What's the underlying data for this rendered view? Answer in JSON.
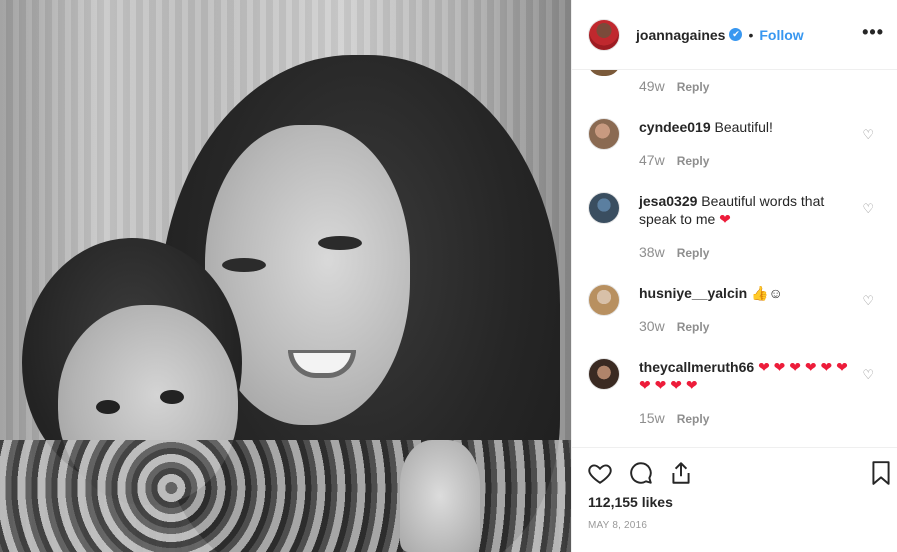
{
  "post": {
    "username": "joannagaines",
    "verified_mark": "✔",
    "separator": "•",
    "follow_label": "Follow",
    "more_label": "•••"
  },
  "comments": {
    "top_partial": {
      "age": "49w",
      "reply_label": "Reply"
    },
    "items": [
      {
        "user": "cyndee019",
        "text": "Beautiful!",
        "emoji": "",
        "age": "47w",
        "reply_label": "Reply"
      },
      {
        "user": "jesa0329",
        "text": "Beautiful words that speak to me",
        "emoji": "❤",
        "age": "38w",
        "reply_label": "Reply"
      },
      {
        "user": "husniye__yalcin",
        "text": "",
        "emoji": "👍☺",
        "age": "30w",
        "reply_label": "Reply"
      },
      {
        "user": "theycallmeruth66",
        "text": "",
        "emoji": "❤ ❤ ❤ ❤ ❤ ❤ ❤ ❤ ❤ ❤",
        "age": "15w",
        "reply_label": "Reply"
      }
    ]
  },
  "actions": {
    "likes": "112,155 likes",
    "date": "MAY 8, 2016",
    "icons": [
      "heart-outline-icon",
      "comment-icon",
      "share-icon",
      "bookmark-icon"
    ]
  },
  "colors": {
    "link": "#3897f0",
    "heart": "#ed1c3a",
    "muted": "#8e8e8e"
  }
}
